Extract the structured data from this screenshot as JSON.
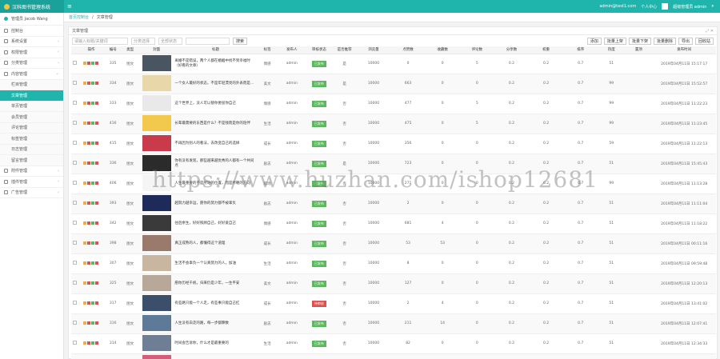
{
  "header": {
    "brand": "汉科图书管理系统",
    "menu_toggle": "≡",
    "top_right_link": "admin@test1.com",
    "top_right_label": "个人中心",
    "user_label": "超级管理员 admin",
    "user_suffix": "▾"
  },
  "sidebar": {
    "user_name": "管理员 Jacob Wang",
    "items": [
      {
        "label": "控制台",
        "chevron": ""
      },
      {
        "label": "系统设置",
        "chevron": "‹"
      },
      {
        "label": "权限管理",
        "chevron": "‹"
      },
      {
        "label": "分类管理",
        "chevron": "‹"
      },
      {
        "label": "内容管理",
        "chevron": "⌄"
      }
    ],
    "sub_items": [
      {
        "label": "栏目管理",
        "active": false
      },
      {
        "label": "文章管理",
        "active": true
      },
      {
        "label": "单页管理",
        "active": false
      },
      {
        "label": "会员管理",
        "active": false
      },
      {
        "label": "评论管理",
        "active": false
      },
      {
        "label": "标签管理",
        "active": false
      },
      {
        "label": "日志管理",
        "active": false
      },
      {
        "label": "留言管理",
        "active": false
      }
    ],
    "bottom_items": [
      {
        "label": "附件管理",
        "chevron": "‹"
      },
      {
        "label": "插件管理",
        "chevron": "‹"
      },
      {
        "label": "广告管理",
        "chevron": "‹"
      }
    ]
  },
  "breadcrumb": {
    "home": "首页控制台",
    "sep": "/",
    "current": "文章管理"
  },
  "panel": {
    "title": "文章管理",
    "tools": "⤢ ✕",
    "search_placeholder": "请输入标题/关键词",
    "select_category": "分类选择",
    "select_status": "全部状态",
    "date_placeholder": "",
    "search_button": "搜索",
    "actions": [
      "添加",
      "批量上架",
      "批量下架",
      "批量删除",
      "导出",
      "回收站"
    ]
  },
  "table": {
    "columns": [
      "",
      "操作",
      "编号",
      "类型",
      "封面",
      "标题",
      "标签",
      "发布人",
      "审核状态",
      "是否推荐",
      "浏览量",
      "点赞数",
      "收藏数",
      "评论数",
      "分享数",
      "权重",
      "排序",
      "热度",
      "置顶",
      "发布时间"
    ],
    "rows": [
      {
        "id": "335",
        "type": "图文",
        "title": "离婚不是错误，两个人都在婚姻中找不到幸福时（好看的文章）",
        "tag": "情感",
        "author": "admin",
        "status": "已发布",
        "status_color": "#5cb85c",
        "rec": "是",
        "views": "10000",
        "likes": "0",
        "favs": "0",
        "comments": "5",
        "shares": "0.2",
        "weight": "0.2",
        "sort": "0.7",
        "hot": "51",
        "top": "",
        "time": "2019年04月11日 15:17:17",
        "thumb": "#4a5562"
      },
      {
        "id": "334",
        "type": "图文",
        "title": "一个女人最好的状态，不是年轻漂亮的外表而是...",
        "tag": "美文",
        "author": "admin",
        "status": "已发布",
        "status_color": "#5cb85c",
        "rec": "是",
        "views": "10000",
        "likes": "663",
        "favs": "0",
        "comments": "0",
        "shares": "0.2",
        "weight": "0.2",
        "sort": "0.7",
        "hot": "99",
        "top": "",
        "time": "2019年04月11日 15:52:57",
        "thumb": "#e8d7a8"
      },
      {
        "id": "333",
        "type": "图文",
        "title": "这个世界上，没人可以替你委屈你自己",
        "tag": "情感",
        "author": "admin",
        "status": "已发布",
        "status_color": "#5cb85c",
        "rec": "否",
        "views": "10000",
        "likes": "477",
        "favs": "0",
        "comments": "5",
        "shares": "0.2",
        "weight": "0.2",
        "sort": "0.7",
        "hot": "99",
        "top": "",
        "time": "2019年04月11日 11:22:23",
        "thumb": "#e9e9e9"
      },
      {
        "id": "416",
        "type": "图文",
        "title": "长辈最需要的东西是什么？不是钱而是你的陪伴",
        "tag": "生活",
        "author": "admin",
        "status": "已发布",
        "status_color": "#5cb85c",
        "rec": "否",
        "views": "10000",
        "likes": "475",
        "favs": "0",
        "comments": "5",
        "shares": "0.2",
        "weight": "0.2",
        "sort": "0.7",
        "hot": "99",
        "top": "",
        "time": "2019年04月11日 11:23:45",
        "thumb": "#f2c94c"
      },
      {
        "id": "415",
        "type": "图文",
        "title": "不再因为别人的看法，去改变自己的选择",
        "tag": "成长",
        "author": "admin",
        "status": "已发布",
        "status_color": "#5cb85c",
        "rec": "否",
        "views": "10000",
        "likes": "356",
        "favs": "0",
        "comments": "0",
        "shares": "0.2",
        "weight": "0.2",
        "sort": "0.7",
        "hot": "59",
        "top": "",
        "time": "2019年04月11日 11:22:13",
        "thumb": "#c93a4a"
      },
      {
        "id": "336",
        "type": "图文",
        "title": "你有没有发现，那些越来越优秀的人都有一个共同点",
        "tag": "励志",
        "author": "admin",
        "status": "已发布",
        "status_color": "#5cb85c",
        "rec": "是",
        "views": "10000",
        "likes": "723",
        "favs": "0",
        "comments": "0",
        "shares": "0.2",
        "weight": "0.2",
        "sort": "0.7",
        "hot": "51",
        "top": "",
        "time": "2019年04月11日 15:45:43",
        "thumb": "#2b2b2b"
      },
      {
        "id": "406",
        "type": "图文",
        "title": "人生最重要的不是所站的位置，而是所朝的方向",
        "tag": "职场",
        "author": "admin",
        "status": "已发布",
        "status_color": "#5cb85c",
        "rec": "否",
        "views": "10000",
        "likes": "271",
        "favs": "0",
        "comments": "0",
        "shares": "0.2",
        "weight": "0.2",
        "sort": "0.7",
        "hot": "99",
        "top": "",
        "time": "2019年04月11日 11:13:28",
        "thumb": "#f5f5f5"
      },
      {
        "id": "393",
        "type": "图文",
        "title": "越努力越幸运，愿你的努力都不被辜负",
        "tag": "励志",
        "author": "admin",
        "status": "已发布",
        "status_color": "#5cb85c",
        "rec": "否",
        "views": "10000",
        "likes": "2",
        "favs": "0",
        "comments": "0",
        "shares": "0.2",
        "weight": "0.2",
        "sort": "0.7",
        "hot": "51",
        "top": "",
        "time": "2019年04月11日 11:11:04",
        "thumb": "#1e2a5a"
      },
      {
        "id": "342",
        "type": "图文",
        "title": "往后余生，好好照顾自己，好好爱自己",
        "tag": "情感",
        "author": "admin",
        "status": "已发布",
        "status_color": "#5cb85c",
        "rec": "否",
        "views": "10000",
        "likes": "681",
        "favs": "4",
        "comments": "0",
        "shares": "0.2",
        "weight": "0.2",
        "sort": "0.7",
        "hot": "51",
        "top": "",
        "time": "2019年04月11日 11:18:22",
        "thumb": "#3a3a3a"
      },
      {
        "id": "398",
        "type": "图文",
        "title": "真正成熟的人，都懂得这个道理",
        "tag": "成长",
        "author": "admin",
        "status": "已发布",
        "status_color": "#5cb85c",
        "rec": "否",
        "views": "10000",
        "likes": "53",
        "favs": "53",
        "comments": "0",
        "shares": "0.2",
        "weight": "0.2",
        "sort": "0.7",
        "hot": "51",
        "top": "",
        "time": "2019年04月11日 00:11:16",
        "thumb": "#9a7b6b"
      },
      {
        "id": "307",
        "type": "图文",
        "title": "生活不会辜负一个认真努力的人，加油",
        "tag": "生活",
        "author": "admin",
        "status": "已发布",
        "status_color": "#5cb85c",
        "rec": "否",
        "views": "10000",
        "likes": "8",
        "favs": "0",
        "comments": "0",
        "shares": "0.2",
        "weight": "0.2",
        "sort": "0.7",
        "hot": "51",
        "top": "",
        "time": "2019年04月11日 09:59:48",
        "thumb": "#c8b6a0"
      },
      {
        "id": "325",
        "type": "图文",
        "title": "愿你历经千帆，归来仍是少年，一生平安",
        "tag": "美文",
        "author": "admin",
        "status": "已发布",
        "status_color": "#5cb85c",
        "rec": "否",
        "views": "10000",
        "likes": "127",
        "favs": "0",
        "comments": "0",
        "shares": "0.2",
        "weight": "0.2",
        "sort": "0.7",
        "hot": "51",
        "top": "",
        "time": "2019年04月11日 12:20:13",
        "thumb": "#b7a89a"
      },
      {
        "id": "317",
        "type": "图文",
        "title": "有些路只能一个人走，有些事只能自己扛",
        "tag": "成长",
        "author": "admin",
        "status": "待审核",
        "status_color": "#d9534f",
        "rec": "否",
        "views": "10000",
        "likes": "2",
        "favs": "4",
        "comments": "0",
        "shares": "0.2",
        "weight": "0.2",
        "sort": "0.7",
        "hot": "51",
        "top": "",
        "time": "2019年04月11日 13:41:02",
        "thumb": "#3c4f6a"
      },
      {
        "id": "316",
        "type": "图文",
        "title": "人生没有白走的路，每一步都算数",
        "tag": "励志",
        "author": "admin",
        "status": "已发布",
        "status_color": "#5cb85c",
        "rec": "否",
        "views": "10000",
        "likes": "211",
        "favs": "14",
        "comments": "0",
        "shares": "0.2",
        "weight": "0.2",
        "sort": "0.7",
        "hot": "51",
        "top": "",
        "time": "2019年04月11日 12:07:41",
        "thumb": "#5d7a98"
      },
      {
        "id": "314",
        "type": "图文",
        "title": "时间会告诉你，什么才是最重要的",
        "tag": "生活",
        "author": "admin",
        "status": "已发布",
        "status_color": "#5cb85c",
        "rec": "否",
        "views": "10000",
        "likes": "82",
        "favs": "0",
        "comments": "0",
        "shares": "0.2",
        "weight": "0.2",
        "sort": "0.7",
        "hot": "51",
        "top": "",
        "time": "2019年04月11日 12:34:33",
        "thumb": "#6e7f95"
      },
      {
        "id": "313",
        "type": "图文",
        "title": "做一个温暖的人，不卑不亢，清澈善良",
        "tag": "美文",
        "author": "admin",
        "status": "已发布",
        "status_color": "#5cb85c",
        "rec": "否",
        "views": "10000",
        "likes": "3892",
        "favs": "201",
        "comments": "0",
        "shares": "0.2",
        "weight": "0.2",
        "sort": "0.7",
        "hot": "51",
        "top": "",
        "time": "2019年04月11日 11:09:37",
        "thumb": "#d45d7a"
      }
    ]
  },
  "watermark": "https://www.huzhan.com/ishop12681"
}
